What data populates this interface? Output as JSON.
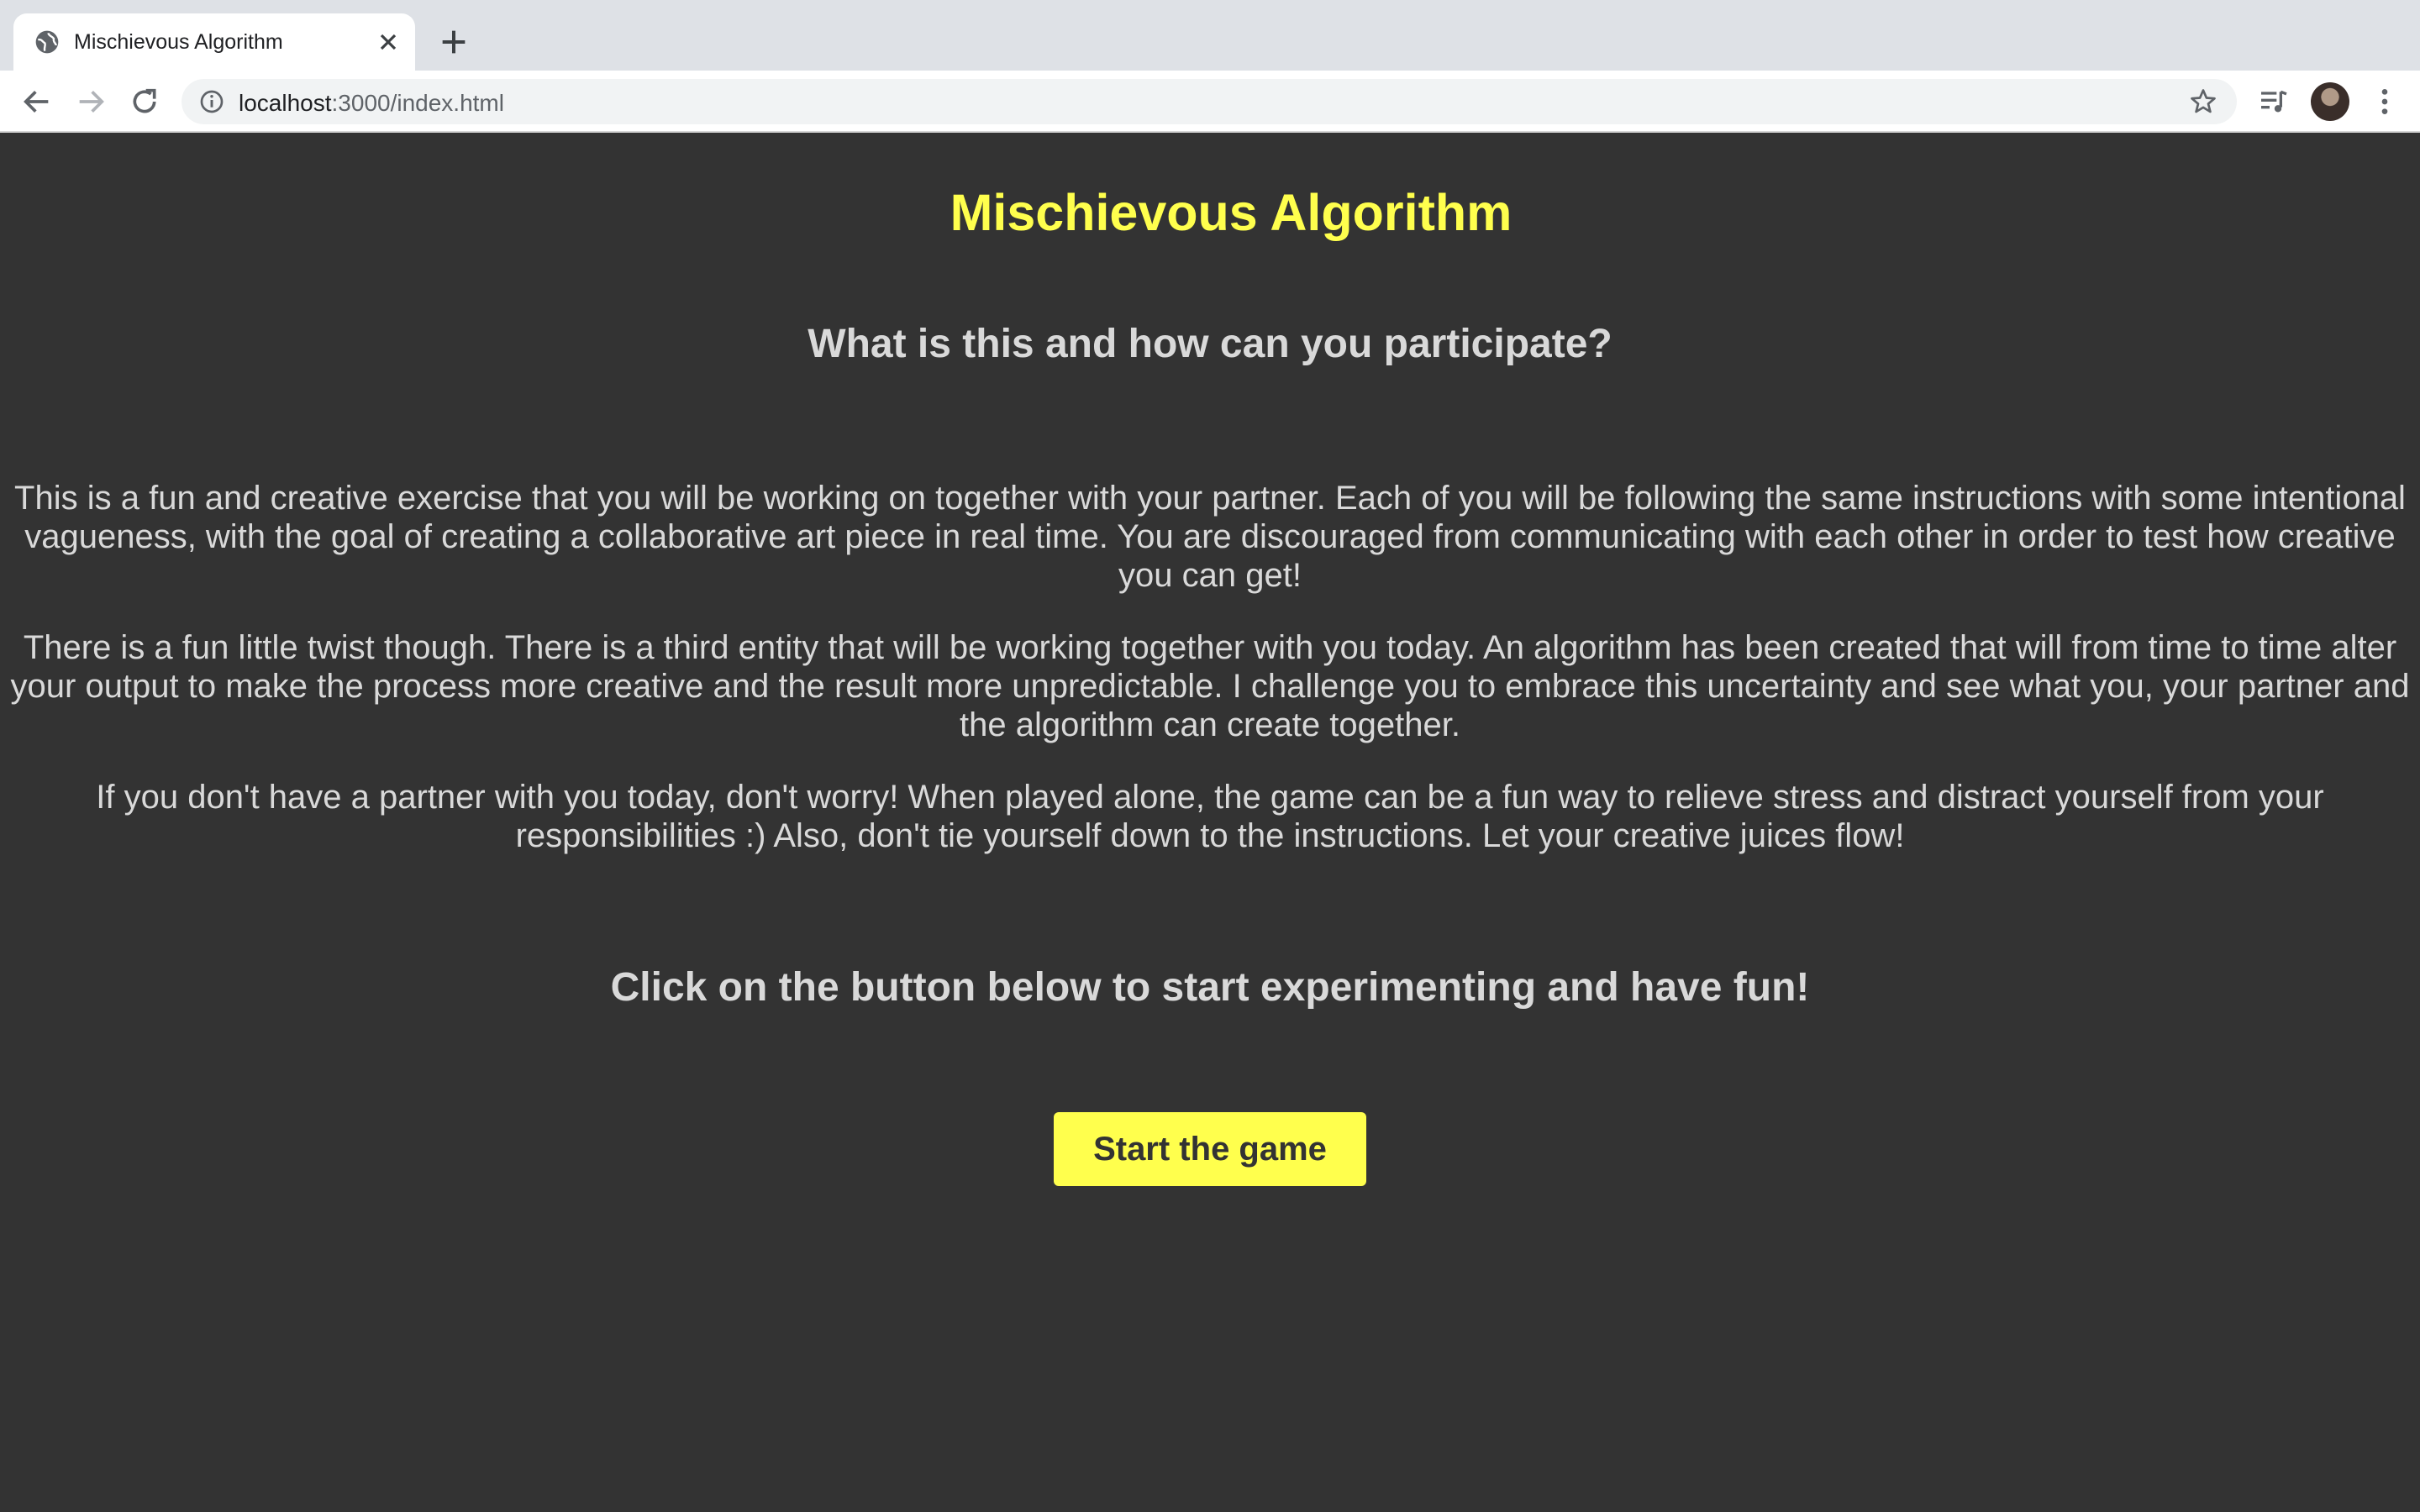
{
  "browser": {
    "tab_title": "Mischievous Algorithm",
    "url_host": "localhost",
    "url_path": ":3000/index.html"
  },
  "page": {
    "title": "Mischievous Algorithm",
    "subtitle": "What is this and how can you participate?",
    "paragraphs": [
      "This is a fun and creative exercise that you will be working on together with your partner. Each of you will be following the same instructions with some intentional vagueness, with the goal of creating a collaborative art piece in real time. You are discouraged from communicating with each other in order to test how creative you can get!",
      "There is a fun little twist though. There is a third entity that will be working together with you today. An algorithm has been created that will from time to time alter your output to make the process more creative and the result more unpredictable. I challenge you to embrace this uncertainty and see what you, your partner and the algorithm can create together.",
      "If you don't have a partner with you today, don't worry! When played alone, the game can be a fun way to relieve stress and distract yourself from your responsibilities :) Also, don't tie yourself down to the instructions. Let your creative juices flow!"
    ],
    "cta_text": "Click on the button below to start experimenting and have fun!",
    "start_button_label": "Start the game"
  },
  "colors": {
    "background": "#333333",
    "accent": "#ffff4d",
    "body_text": "#d9d9d9"
  }
}
